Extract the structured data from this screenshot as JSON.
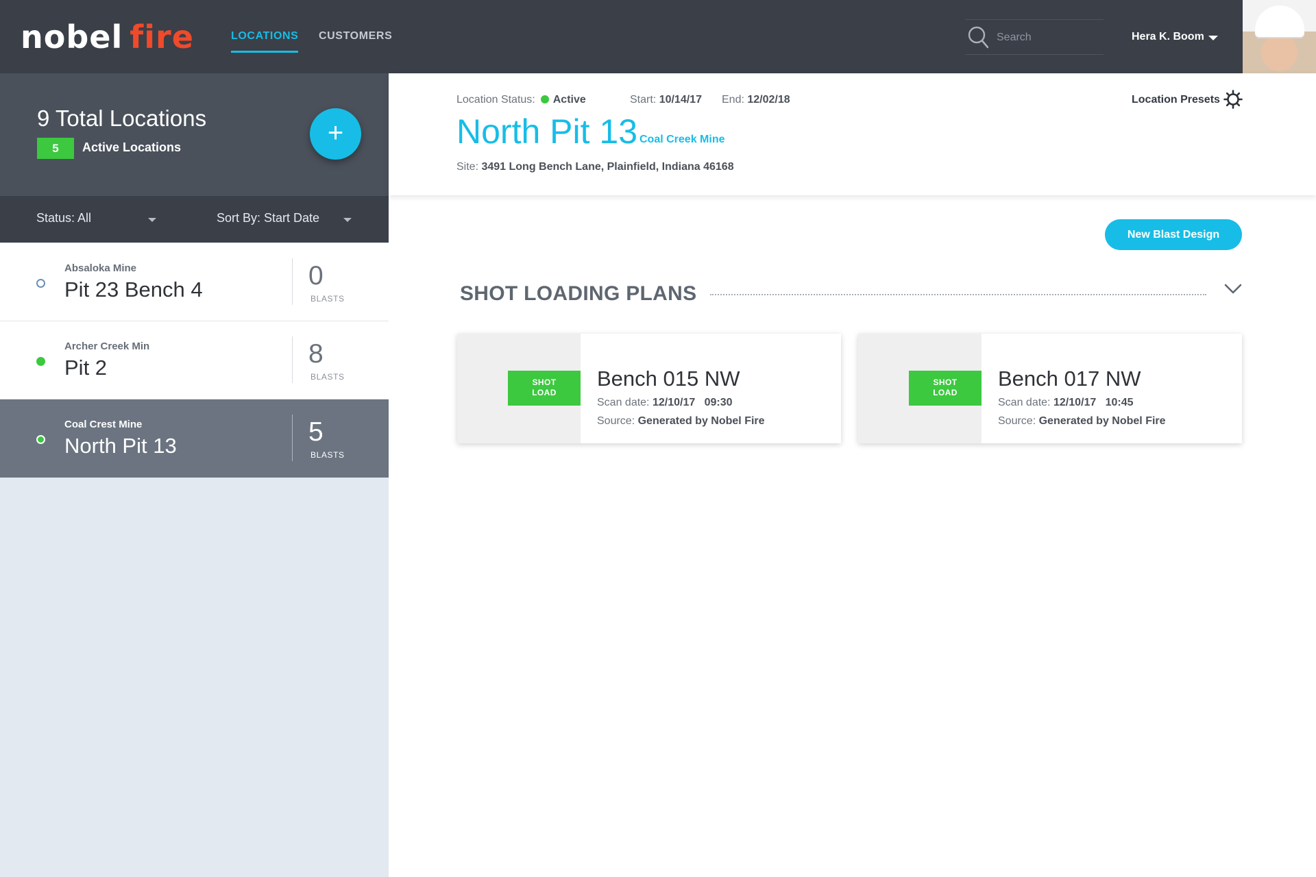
{
  "header": {
    "logo_left": "nobel",
    "logo_right": "fire",
    "tabs": [
      {
        "label": "LOCATIONS",
        "active": true
      },
      {
        "label": "CUSTOMERS",
        "active": false
      }
    ],
    "search": {
      "placeholder": "Search",
      "icon": "search-icon"
    },
    "user": {
      "name": "Hera K. Boom",
      "icon": "chevron-down-icon"
    }
  },
  "sidebar": {
    "total": "9 Total Locations",
    "active_count": "5",
    "active_label": "Active Locations",
    "add_label": "+",
    "filters": {
      "status": "Status: All",
      "sort": "Sort By: Start Date"
    },
    "locations": [
      {
        "mine": "Absaloka  Mine",
        "name": "Pit 23 Bench 4",
        "count": "0",
        "unit": "BLASTS",
        "status": "inactive",
        "selected": false
      },
      {
        "mine": "Archer Creek Min",
        "name": "Pit 2",
        "count": "8",
        "unit": "BLASTS",
        "status": "active",
        "selected": false
      },
      {
        "mine": "Coal Crest Mine",
        "name": "North Pit 13",
        "count": "5",
        "unit": "BLASTS",
        "status": "active",
        "selected": true
      }
    ]
  },
  "detail": {
    "status_label": "Location Status:",
    "status_value": "Active",
    "start_label": "Start:",
    "start_value": "10/14/17",
    "end_label": "End:",
    "end_value": "12/02/18",
    "title": "North Pit 13",
    "subtitle": "Coal Creek Mine",
    "site_label": "Site:",
    "site_value": "3491 Long Bench Lane, Plainfield, Indiana 46168",
    "presets_label": "Location Presets",
    "presets_icon": "gear-icon",
    "new_blast_label": "New Blast Design",
    "section_title": "SHOT LOADING PLANS",
    "plans": [
      {
        "tag_line1": "SHOT",
        "tag_line2": "LOAD",
        "name": "Bench 015 NW",
        "scan_label": "Scan date:",
        "scan_value": "12/10/17   09:30",
        "source_label": "Source:",
        "source_value": "Generated by Nobel Fire"
      },
      {
        "tag_line1": "SHOT",
        "tag_line2": "LOAD",
        "name": "Bench 017 NW",
        "scan_label": "Scan date:",
        "scan_value": "12/10/17   10:45",
        "source_label": "Source:",
        "source_value": "Generated by Nobel Fire"
      }
    ]
  },
  "colors": {
    "accent": "#17bde6",
    "active_green": "#3cc83f",
    "topbar": "#3a3f48",
    "logo_red": "#f04a2a"
  }
}
